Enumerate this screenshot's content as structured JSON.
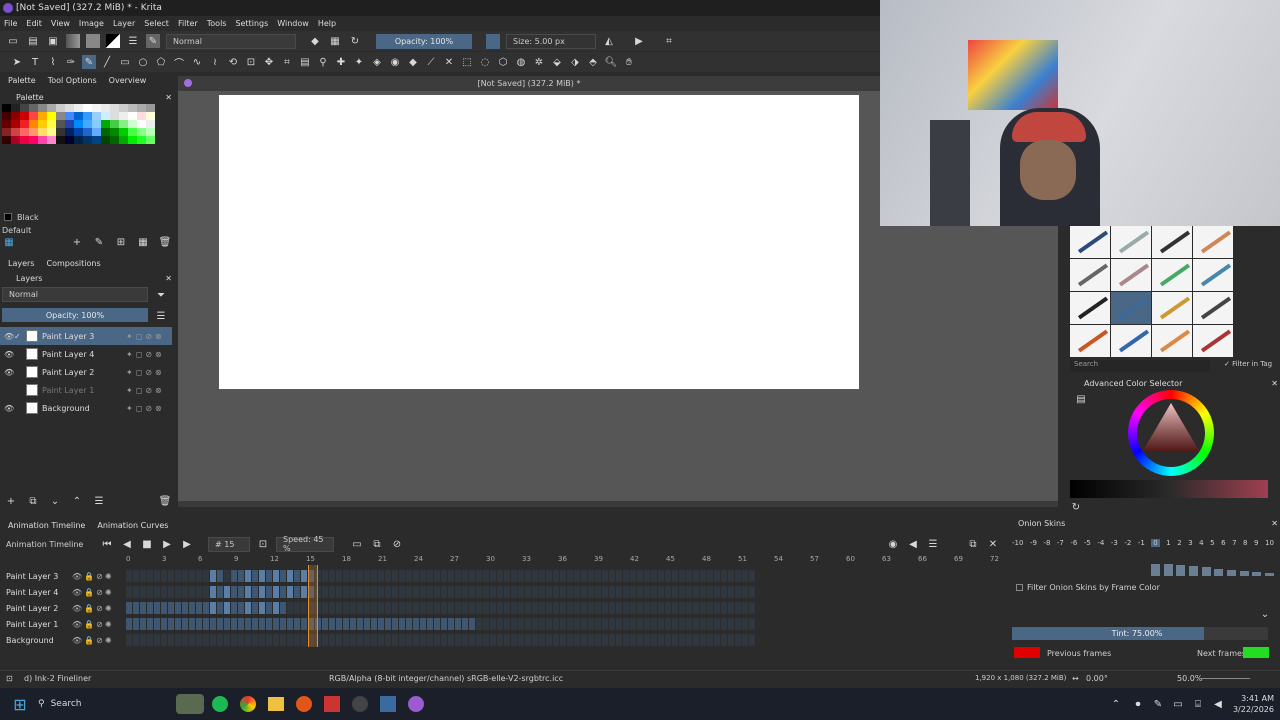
{
  "window": {
    "title": "[Not Saved]  (327.2 MiB) * - Krita"
  },
  "menu": [
    "File",
    "Edit",
    "View",
    "Image",
    "Layer",
    "Select",
    "Filter",
    "Tools",
    "Settings",
    "Window",
    "Help"
  ],
  "toolbar": {
    "blend_mode": "Normal",
    "opacity": "Opacity: 100%",
    "size": "Size: 5.00 px"
  },
  "left_dock": {
    "tabs": [
      "Palette",
      "Tool Options",
      "Overview"
    ],
    "palette_title": "Palette",
    "current_color_name": "Black",
    "palette_name": "Default",
    "layers_tabs": [
      "Layers",
      "Compositions"
    ],
    "layers_title": "Layers",
    "layer_blend": "Normal",
    "layer_opacity": "Opacity:  100%",
    "layers": [
      {
        "name": "Paint Layer 3",
        "selected": true,
        "visible": true
      },
      {
        "name": "Paint Layer 4",
        "selected": false,
        "visible": true
      },
      {
        "name": "Paint Layer 2",
        "selected": false,
        "visible": true
      },
      {
        "name": "Paint Layer 1",
        "selected": false,
        "visible": false
      },
      {
        "name": "Background",
        "selected": false,
        "visible": true
      }
    ]
  },
  "canvas": {
    "doc_title": "[Not Saved]  (327.2 MiB) *"
  },
  "right_dock": {
    "brush_search_placeholder": "Search",
    "filter_in_tag": "Filter in Tag",
    "color_selector_title": "Advanced Color Selector",
    "onion_title": "Onion Skins",
    "onion_numbers": [
      "-10",
      "-9",
      "-8",
      "-7",
      "-6",
      "-5",
      "-4",
      "-3",
      "-2",
      "-1",
      "0",
      "1",
      "2",
      "3",
      "4",
      "5",
      "6",
      "7",
      "8",
      "9",
      "10"
    ],
    "filter_onion": "Filter Onion Skins by Frame Color",
    "tint": "Tint: 75.00%",
    "tint_level": 0.75,
    "previous_frames": "Previous frames",
    "next_frames": "Next frames",
    "prev_color": "#e00000",
    "next_color": "#22dd22"
  },
  "timeline": {
    "tabs": [
      "Animation Timeline",
      "Animation Curves"
    ],
    "title": "Animation Timeline",
    "frame": "# 15",
    "speed": "Speed: 45 %",
    "ruler": [
      "0",
      "3",
      "6",
      "9",
      "12",
      "15",
      "18",
      "21",
      "24",
      "27",
      "30",
      "33",
      "36",
      "39",
      "42",
      "45",
      "48",
      "51",
      "54",
      "57",
      "60",
      "63",
      "66",
      "69",
      "72"
    ],
    "rows": [
      "Paint Layer 3",
      "Paint Layer 4",
      "Paint Layer 2",
      "Paint Layer 1",
      "Background"
    ]
  },
  "status": {
    "brush": "d) Ink-2 Fineliner",
    "color_profile": "RGB/Alpha (8-bit integer/channel)  sRGB-elle-V2-srgbtrc.icc",
    "dimensions": "1,920 x 1,080 (327.2 MiB)",
    "rotation": "0.00°",
    "zoom": "50.0%"
  },
  "taskbar": {
    "search": "Search",
    "time": "3:41 AM",
    "date": "3/22/2026"
  }
}
